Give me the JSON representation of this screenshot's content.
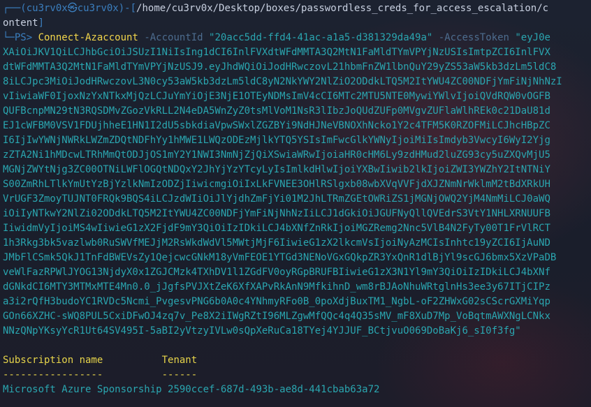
{
  "prompt": {
    "corner_top": "┌──(",
    "user": "cu3rv0x",
    "skull": "㉿",
    "host": "cu3rv0x",
    "mid": ")-[",
    "path": "/home/cu3rv0x/Desktop/boxes/passwordless_creds_for_access_escalation/c",
    "path_wrap": "ontent",
    "close": "]",
    "corner_bottom": "└─",
    "ps": "PS> "
  },
  "command": {
    "cmdlet": "Connect-Azaccount",
    "param1": "-AccountId",
    "account_id": "\"20acc5dd-ffd4-41ac-a1a5-d381329da49a\"",
    "param2": "-AccessToken",
    "token_start": "\"eyJ0e",
    "token_lines": [
      "XAiOiJKV1QiLCJhbGciOiJSUzI1NiIsIng1dCI6InlFVXdtWFdMMTA3Q2MtN1FaMldTYmVPYjNzUSIsImtpZCI6InlFVX",
      "dtWFdMMTA3Q2MtN1FaMldTYmVPYjNzUSJ9.eyJhdWQiOiJodHRwczovL21hbmFnZW1lbnQuY29yZS53aW5kb3dzLm5ldC8",
      "8iLCJpc3MiOiJodHRwczovL3N0cy53aW5kb3dzLm5ldC8yN2NkYWY2NlZiO2ODdkLTQ5M2ItYWU4ZC00NDFjYmFiNjNhNzI",
      "vIiwiaWF0IjoxNzYxNTkxMjQzLCJuYmYiOjE3NjE1OTEyNDMsImV4cCI6MTc2MTU5NTE0MywiYWlvIjoiQVdRQW0vOGFB",
      "QUFBcnpMN29tN3RQSDMvZGozVkRLL2N4eDA5WnZyZ0tsMlVoM1NsR3lIbzJoQUdZUFp0MVgvZUFlaWlhREk0c21DaU81d",
      "EJ1cWFBM0VSV1FDUjhheE1HN1I2dU5sbkdiaVpwSWxlZGZBYi9NdHJNeVBNOXhNcko1Y2c4TFM5K0RZOFMiLCJhcHBpZC",
      "I6IjIwYWNjNWRkLWZmZDQtNDFhYy1hMWE1LWQzODEzMjlkYTQ5YSIsImFwcGlkYWNyIjoiMiIsImdyb3VwcyI6WyI2Yjg",
      "zZTA2Ni1hMDcwLTRhMmQtODJjOS1mY2Y1NWI3NmNjZjQiXSwiaWRwIjoiaHR0cHM6Ly9zdHMud2luZG93cy5uZXQvMjU5",
      "MGNjZWYtNjg3ZC00OTNiLWFlOGQtNDQxY2JhYjYzYTcyLyIsImlkdHlwIjoiYXBwIiwib2lkIjoiZWI3YWZhY2ItNTNiY",
      "S00ZmRhLTlkYmUtYzBjYzlkNmIzODZjIiwicmgiOiIxLkFVNEE3OHlRSlgxb08wbXVqVVFjdXJZNmNrWklmM2tBdXRkUH",
      "VrUGF3ZmoyTUJNT0FRQk9BQS4iLCJzdWIiOiJlYjdhZmFjYi01M2JhLTRmZGEtOWRiZS1jMGNjOWQ2YjM4NmMiLCJ0aWQ",
      "iOiIyNTkwY2NlZi02ODdkLTQ5M2ItYWU4ZC00NDFjYmFiNjNhNzIiLCJ1dGkiOiJGUFNyQllQVEdrS3VtY1NHLXRNUUFB",
      "IiwidmVyIjoiMS4wIiwieG1zX2FjdF9mY3QiOiIzIDkiLCJ4bXNfZnRkIjoiMGZRemg2Nnc5VlB4N2FyTy00T1FrVlRCT",
      "1h3Rkg3bk5vazlwb0RuSWVfMEJjM2RsWkdWdVl5MWtjMjF6IiwieG1zX2lkcmVsIjoiNyAzMCIsInhtc19yZCI6IjAuND",
      "JMbFlCSmk5QkJ1TnFdBWEVsZy1QejcwcGNkM18yVmFEOE1YTGd3NENoVGxGQkpZR3YxQnR1dlBjYl9scGJ6bmx5XzVPaDB",
      "veWlFazRPWlJYOG13NjdyX0x1ZGJCMzk4TXhDV1l1ZGdFV0oyRGpBRUFBIiwieG1zX3N1Yl9mY3QiOiIzIDkiLCJ4bXNf",
      "dGNkdCI6MTY3MTMxMTE4Mn0.0_jJgfsPVJXtZeK6XfXAPvRkAnN9MfkihnD_wm8rBJAoNhuWRtglnHs3ee3y67ITjCIPz",
      "a3i2rQfH3budoYC1RVDc5Ncmi_PvgesvPNG6b0A0c4YNhmyRFo0B_0poXdjBuxTM1_NgbL-oF2ZHWxG02sCScrGXMiYqp",
      "GOn66XZHC-sWQ8PUL5CxiDFwOJ4zq7v_Pe8X2iIWgRZtI96MLZgwMfQQc4q4Q35sMV_mF8XuD7Mp_VoBqtmAWXNgLCNkx",
      "NNzQNpYKsyYcR1Ut64SV495I-5aBI2yVtzyIVLw0sQpXeRuCa18TYej4YJJUF_BCtjvuO069DoBaKj6_sI0f3fg\""
    ]
  },
  "output": {
    "header_name": "Subscription name",
    "header_tenant": "Tenant",
    "rule_name": "-----------------",
    "rule_tenant": "------",
    "row_name": "Microsoft Azure Sponsorship",
    "row_tenant": "2590ccef-687d-493b-ae8d-441cbab63a72"
  }
}
